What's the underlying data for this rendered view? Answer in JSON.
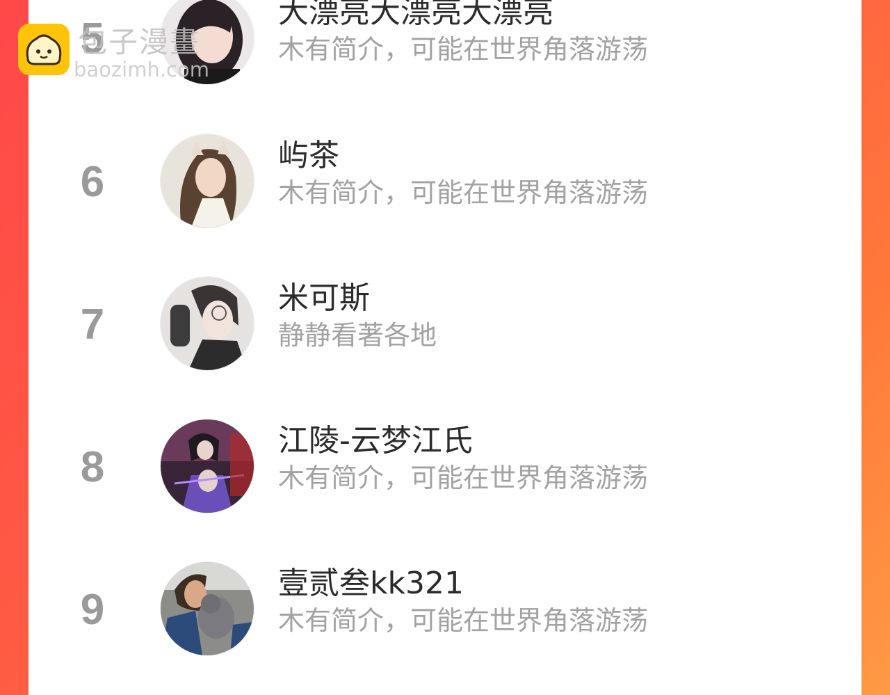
{
  "watermark": {
    "brand": "包子漫畫",
    "url": "baozimh.com",
    "icon": "bun-face-icon",
    "icon_color": "#ffc40a"
  },
  "colors": {
    "background_gradient": [
      "#ff4848",
      "#ff9a44"
    ],
    "rank": "#9a9a9a",
    "name": "#2b2b2b",
    "bio": "#a2a2a2"
  },
  "list": [
    {
      "rank": "5",
      "name": "大漂亮大漂亮大漂亮",
      "bio": "木有简介，可能在世界角落游荡",
      "avatar": "avatar-girl-short-hair"
    },
    {
      "rank": "6",
      "name": "屿茶",
      "bio": "木有简介，可能在世界角落游荡",
      "avatar": "avatar-fox-ear-anime"
    },
    {
      "rank": "7",
      "name": "米可斯",
      "bio": "静静看著各地",
      "avatar": "avatar-glasses-anime"
    },
    {
      "rank": "8",
      "name": "江陵-云梦江氏",
      "bio": "木有简介，可能在世界角落游荡",
      "avatar": "avatar-purple-anime-duo"
    },
    {
      "rank": "9",
      "name": "壹贰叁kk321",
      "bio": "木有简介，可能在世界角落游荡",
      "avatar": "avatar-woman-with-cat"
    }
  ]
}
